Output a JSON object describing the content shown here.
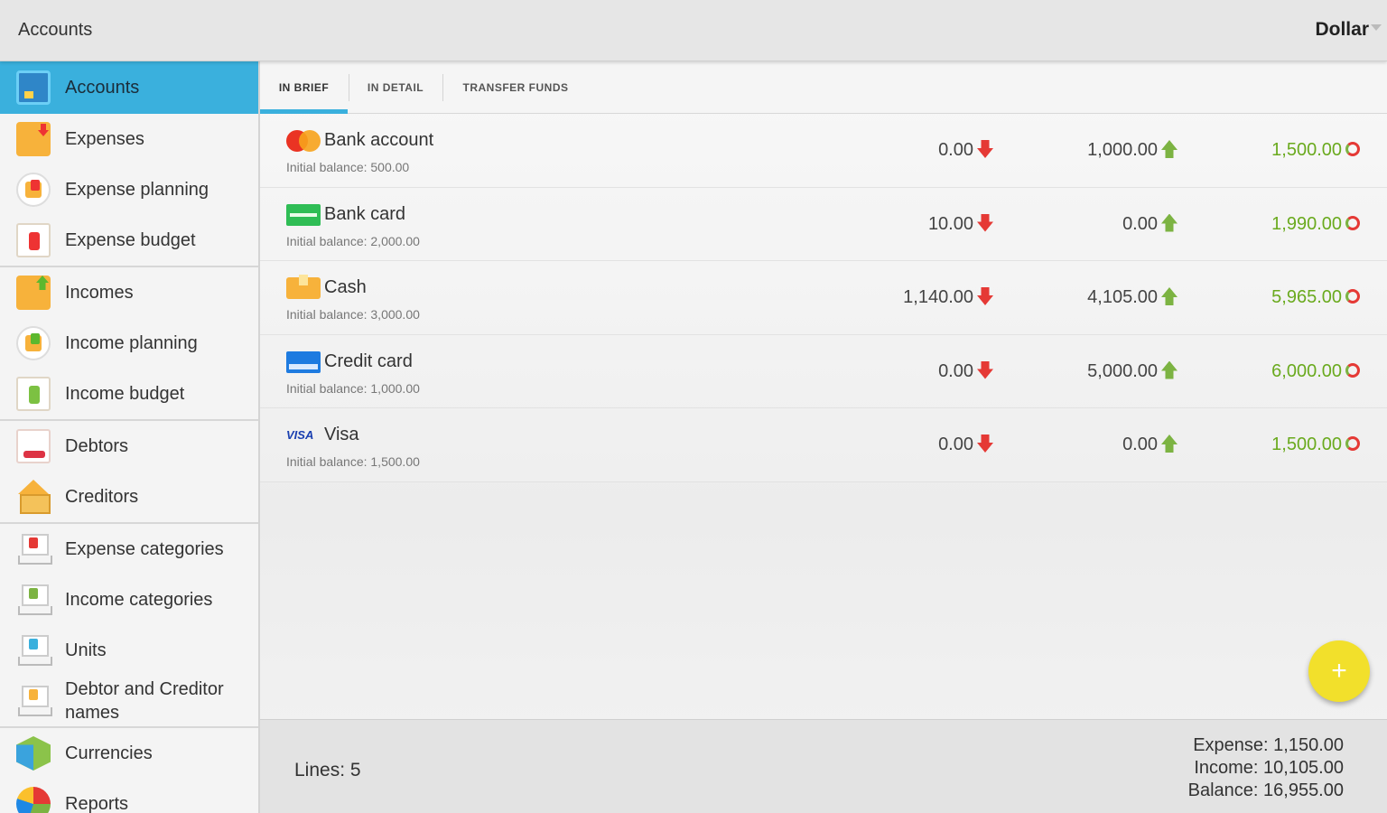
{
  "header": {
    "title": "Accounts",
    "currency": "Dollar"
  },
  "sidebar": {
    "items": [
      {
        "label": "Accounts",
        "icon": "accounts-icon"
      },
      {
        "label": "Expenses",
        "icon": "expenses-icon"
      },
      {
        "label": "Expense planning",
        "icon": "expense-planning-icon"
      },
      {
        "label": "Expense budget",
        "icon": "expense-budget-icon"
      },
      {
        "label": "Incomes",
        "icon": "incomes-icon"
      },
      {
        "label": "Income planning",
        "icon": "income-planning-icon"
      },
      {
        "label": "Income budget",
        "icon": "income-budget-icon"
      },
      {
        "label": "Debtors",
        "icon": "debtors-icon"
      },
      {
        "label": "Creditors",
        "icon": "creditors-icon"
      },
      {
        "label": "Expense categories",
        "icon": "expense-categories-icon"
      },
      {
        "label": "Income categories",
        "icon": "income-categories-icon"
      },
      {
        "label": "Units",
        "icon": "units-icon"
      },
      {
        "label": "Debtor and Creditor names",
        "icon": "names-icon"
      },
      {
        "label": "Currencies",
        "icon": "currencies-icon"
      },
      {
        "label": "Reports",
        "icon": "reports-icon"
      }
    ]
  },
  "tabs": [
    {
      "label": "IN BRIEF"
    },
    {
      "label": "IN DETAIL"
    },
    {
      "label": "TRANSFER FUNDS"
    }
  ],
  "accounts": [
    {
      "name": "Bank account",
      "initial": "Initial balance: 500.00",
      "expense": "0.00",
      "income": "1,000.00",
      "balance": "1,500.00",
      "icon": "mastercard-icon"
    },
    {
      "name": "Bank card",
      "initial": "Initial balance: 2,000.00",
      "expense": "10.00",
      "income": "0.00",
      "balance": "1,990.00",
      "icon": "bank-card-icon"
    },
    {
      "name": "Cash",
      "initial": "Initial balance: 3,000.00",
      "expense": "1,140.00",
      "income": "4,105.00",
      "balance": "5,965.00",
      "icon": "cash-icon"
    },
    {
      "name": "Credit card",
      "initial": "Initial balance: 1,000.00",
      "expense": "0.00",
      "income": "5,000.00",
      "balance": "6,000.00",
      "icon": "credit-card-icon"
    },
    {
      "name": "Visa",
      "initial": "Initial balance: 1,500.00",
      "expense": "0.00",
      "income": "0.00",
      "balance": "1,500.00",
      "icon": "visa-icon",
      "icon_text": "VISA"
    }
  ],
  "footer": {
    "lines": "Lines: 5",
    "expense": "Expense: 1,150.00",
    "income": "Income: 10,105.00",
    "balance": "Balance: 16,955.00"
  },
  "fab": {
    "label": "+"
  },
  "colors": {
    "accent": "#3ab0dd",
    "fab": "#f2e02b",
    "balance_text": "#6aaa1e",
    "expense_arrow": "#e53935",
    "income_arrow": "#7cb342"
  }
}
